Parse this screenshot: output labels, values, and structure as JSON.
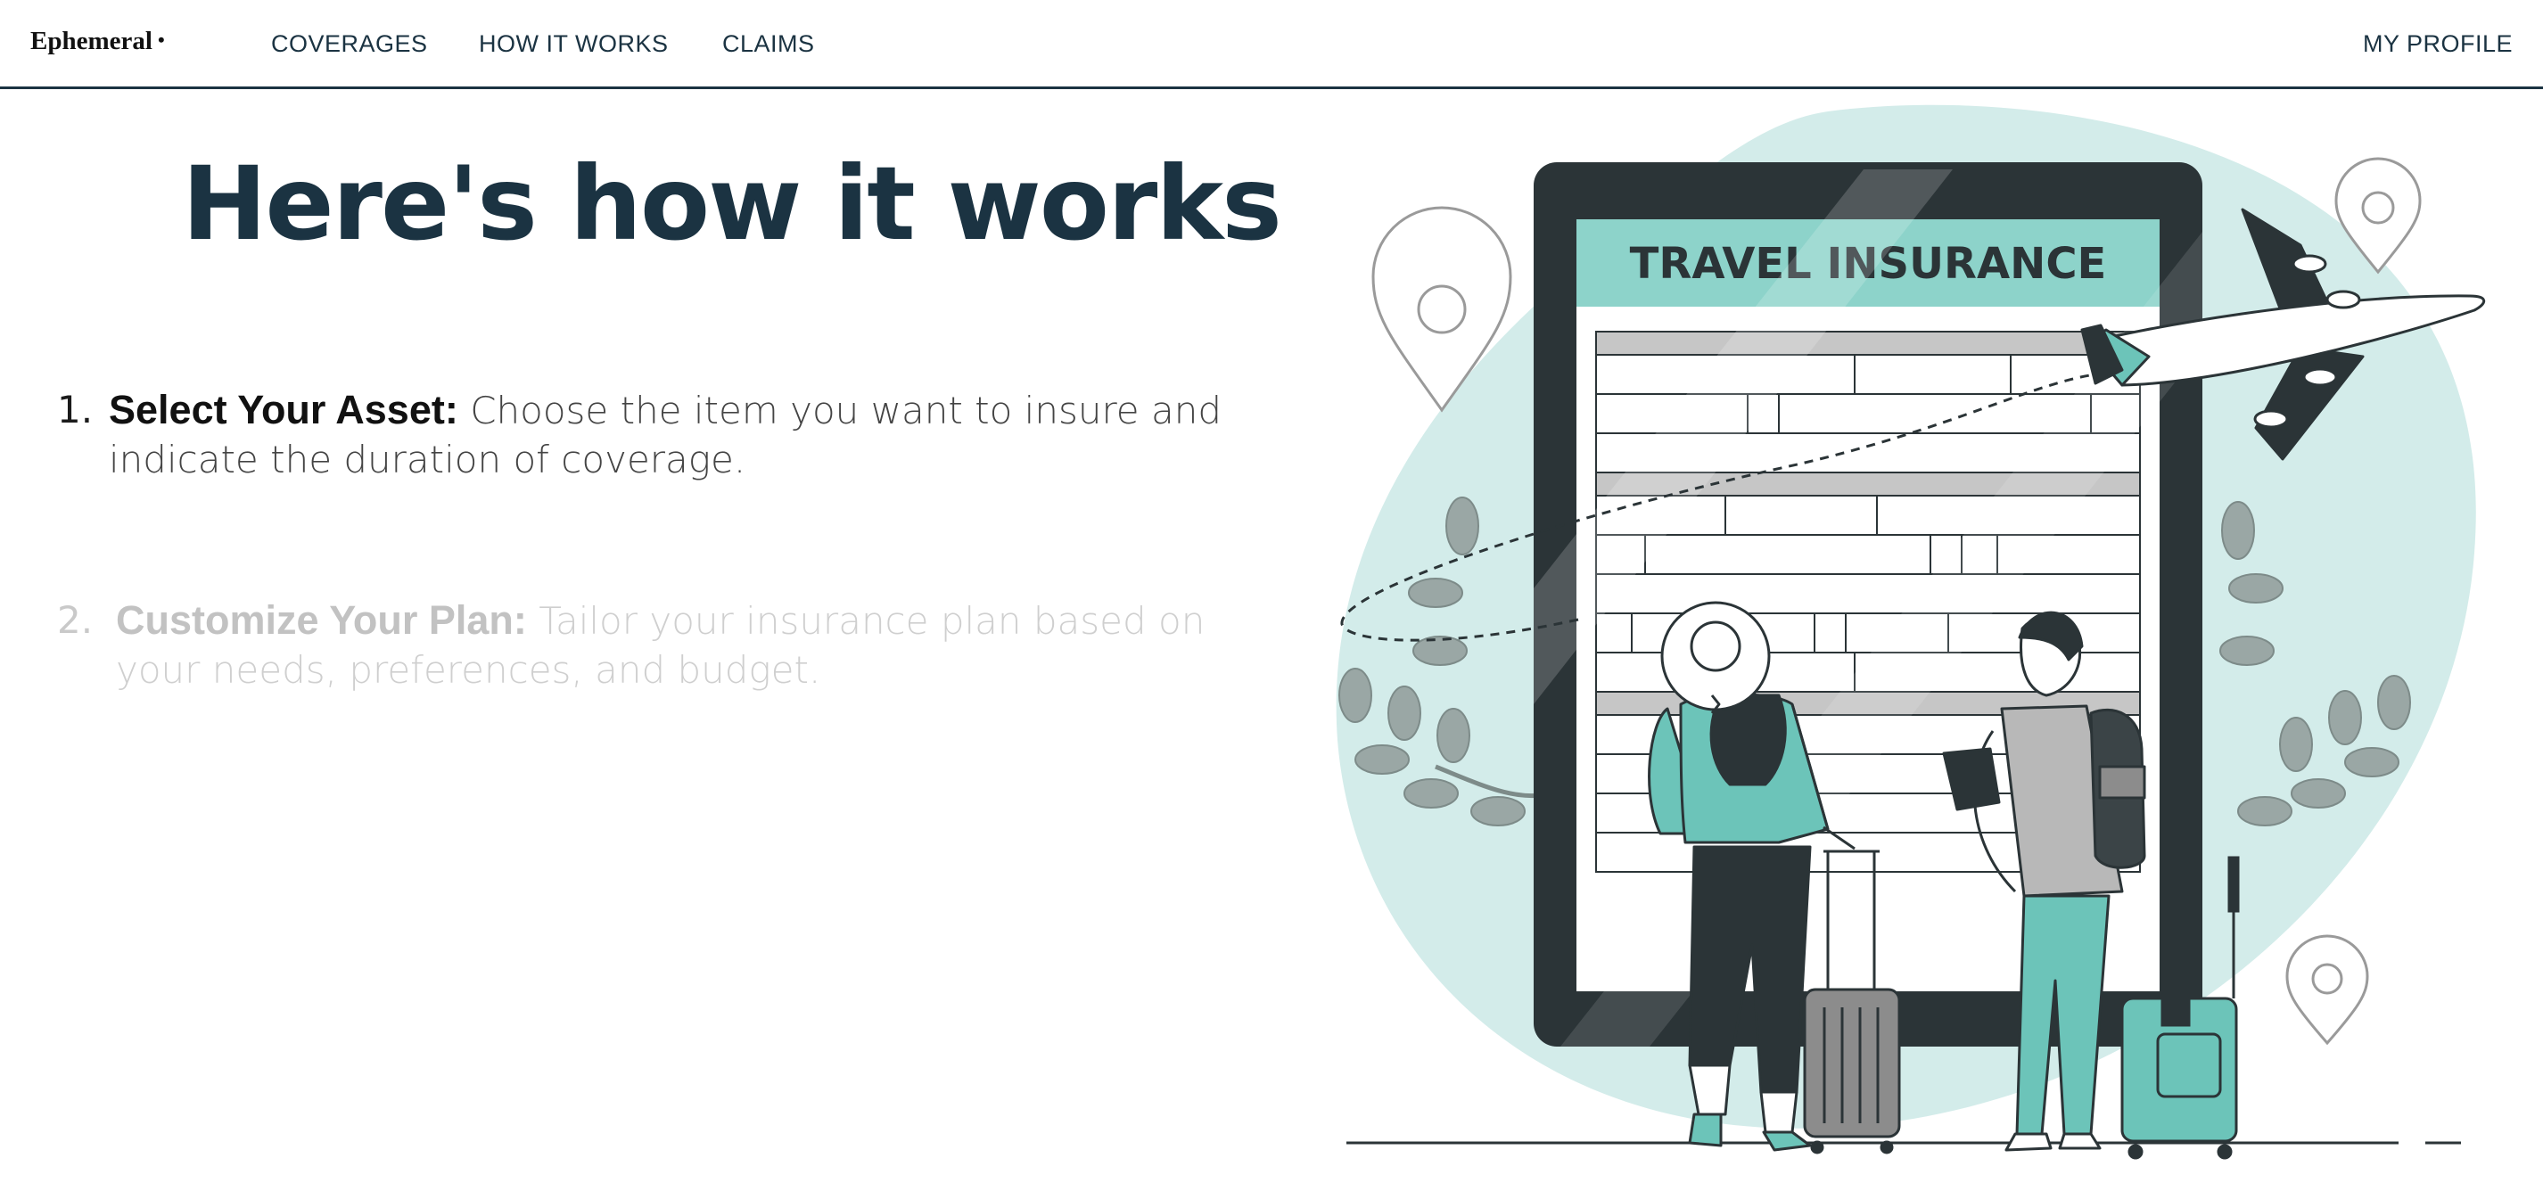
{
  "nav": {
    "brand": "Ephemeral",
    "brand_dot": "•",
    "links": [
      "COVERAGES",
      "HOW IT WORKS",
      "CLAIMS"
    ],
    "profile": "MY PROFILE"
  },
  "hero": {
    "headline": "Here's how it works",
    "steps": [
      {
        "number": "1.",
        "title": "Select Your Asset:",
        "text": "Choose the item you want to insure and indicate the duration of coverage.",
        "state": "active"
      },
      {
        "number": "2.",
        "title": "Customize Your Plan:",
        "text": "Tailor your insurance plan based on your needs, preferences, and budget.",
        "state": "inactive"
      }
    ]
  },
  "illustration": {
    "banner_text": "TRAVEL INSURANCE",
    "icons": [
      "map-pin-icon",
      "airplane-icon",
      "suitcase-icon",
      "backpack-icon",
      "tablet-icon"
    ],
    "colors": {
      "teal": "#6cc4b9",
      "light_teal": "#d3ecea",
      "dark": "#2b3437",
      "gray": "#9aa7a5"
    }
  }
}
